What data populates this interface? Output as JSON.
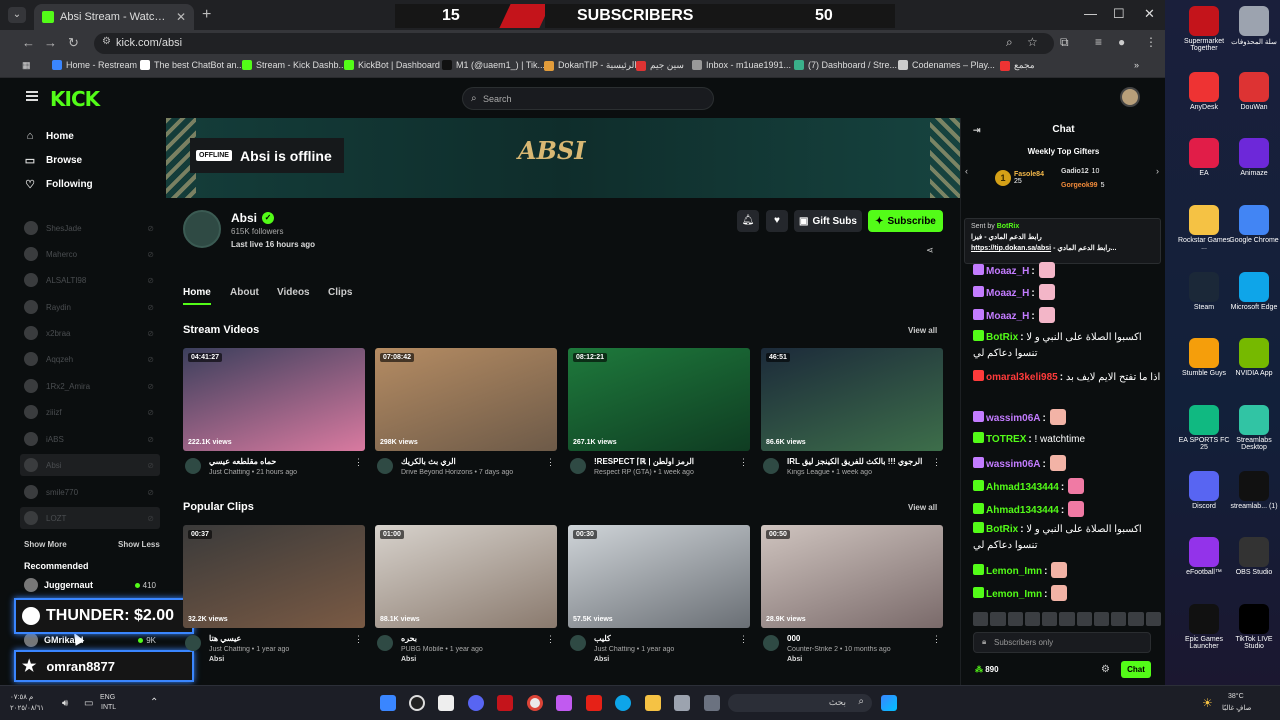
{
  "browser": {
    "tab_title": "Absi Stream - Watch Live on Kick",
    "url": "kick.com/absi",
    "bookmarks": [
      "Home - Restream",
      "The best ChatBot an...",
      "Stream - Kick Dashb...",
      "KickBot | Dashboard",
      "M1 (@uaem1_) | Tik...",
      "DokanTIP - الرئيسية",
      "سين جيم",
      "Inbox - m1uae1991...",
      "(7) Dashboard / Stre...",
      "Codenames – Play...",
      "مجمع"
    ]
  },
  "overlay": {
    "count_left": "15",
    "label": "SUBSCRIBERS",
    "count_right": "50",
    "donation": "THUNDER: $2.00",
    "follower": "omran8877"
  },
  "kick": {
    "search_placeholder": "Search",
    "nav": {
      "home": "Home",
      "browse": "Browse",
      "following": "Following"
    },
    "following_list": [
      "ShesJade",
      "Maherco",
      "ALSALTI98",
      "Raydin",
      "x2braa",
      "Aqqzeh",
      "1Rx2_Amira",
      "ziiizf",
      "iABS",
      "Absi",
      "smile770",
      "LOZT"
    ],
    "show_more": "Show More",
    "show_less": "Show Less",
    "recommended_title": "Recommended",
    "recommended": [
      {
        "name": "Juggernaut",
        "count": "410"
      },
      {
        "name": "GMrikard",
        "count": "9K"
      }
    ]
  },
  "channel": {
    "offline_badge": "OFFLINE",
    "offline_text": "Absi is offline",
    "banner_brand": "ABSI",
    "name": "Absi",
    "followers": "615K followers",
    "last_live": "Last live 16 hours ago",
    "gift_subs": "Gift Subs",
    "subscribe": "Subscribe",
    "tabs": [
      "Home",
      "About",
      "Videos",
      "Clips"
    ],
    "stream_videos_title": "Stream Videos",
    "popular_clips_title": "Popular Clips",
    "view_all": "View all",
    "videos": [
      {
        "duration": "04:41:27",
        "views": "222.1K views",
        "title": "حماه مقلطعه عيسي",
        "meta": "Just Chatting • 21 hours ago",
        "colors": [
          "#3b3f5c",
          "#d97aa0"
        ]
      },
      {
        "duration": "07:08:42",
        "views": "298K views",
        "title": "الري بث بالكريك",
        "meta": "Drive Beyond Horizons • 7 days ago",
        "colors": [
          "#b58c63",
          "#6d5a48"
        ]
      },
      {
        "duration": "08:12:21",
        "views": "267.1K views",
        "title": "!RESPECT ⌈ℝ | الرمز اولطن",
        "meta": "Respect RP (GTA) • 1 week ago",
        "colors": [
          "#1e7a3c",
          "#0f3c22"
        ]
      },
      {
        "duration": "46:51",
        "views": "86.6K views",
        "title": "IRL الرجوي !!! بالكث للفريق الكينجز ليق",
        "meta": "Kings League • 1 week ago",
        "colors": [
          "#1c2a3a",
          "#3d6e4a"
        ]
      }
    ],
    "clips": [
      {
        "duration": "00:37",
        "views": "32.2K views",
        "title": "عيسي هتا",
        "meta": "Just Chatting • 1 year ago",
        "author": "Absi",
        "colors": [
          "#3a3a3a",
          "#7a5a44"
        ]
      },
      {
        "duration": "01:00",
        "views": "88.1K views",
        "title": "بحره",
        "meta": "PUBG Mobile • 1 year ago",
        "author": "Absi",
        "colors": [
          "#d7d2cc",
          "#8a7a6e"
        ]
      },
      {
        "duration": "00:30",
        "views": "57.5K views",
        "title": "كليب",
        "meta": "Just Chatting • 1 year ago",
        "author": "Absi",
        "colors": [
          "#cfd4d8",
          "#6a6f75"
        ]
      },
      {
        "duration": "00:50",
        "views": "28.9K views",
        "title": "000",
        "meta": "Counter-Strike 2 • 10 months ago",
        "author": "Absi",
        "colors": [
          "#cfc4bf",
          "#7a6a6a"
        ]
      }
    ]
  },
  "chat": {
    "title": "Chat",
    "gifters_title": "Weekly Top Gifters",
    "gifters": [
      {
        "name": "Fasole84",
        "count": "25"
      },
      {
        "name": "Gadio12",
        "count": "10"
      },
      {
        "name": "Gorgeok99",
        "count": "5"
      }
    ],
    "medal": "1",
    "pinned": {
      "sent_by": "Sent by",
      "bot": "BotRix",
      "line1": "رابط الدعم المادي - فيزا",
      "line2_link": "https://tip.dokan.sa/absi",
      "line2_rest": " - رابط الدعم المادي..."
    },
    "messages": [
      {
        "user": "Moaaz_H",
        "color": "#c37cff",
        "text": ""
      },
      {
        "user": "Moaaz_H",
        "color": "#c37cff",
        "text": ""
      },
      {
        "user": "Moaaz_H",
        "color": "#c37cff",
        "text": ""
      },
      {
        "user": "BotRix",
        "color": "#53fc18",
        "text": "اكسبوا الصلاة على النبي و لا تنسوا دعاكم لي"
      },
      {
        "user": "omaral3keli985",
        "color": "#ff3b3b",
        "text": "اذا ما تفتح الايم لايف بد"
      },
      {
        "user": "wassim06A",
        "color": "#c37cff",
        "text": ""
      },
      {
        "user": "TOTREX",
        "color": "#53fc18",
        "text": "! watchtime"
      },
      {
        "user": "wassim06A",
        "color": "#c37cff",
        "text": ""
      },
      {
        "user": "Ahmad1343444",
        "color": "#53fc18",
        "text": ""
      },
      {
        "user": "Ahmad1343444",
        "color": "#53fc18",
        "text": ""
      },
      {
        "user": "BotRix",
        "color": "#53fc18",
        "text": "اكسبوا الصلاة على النبي و لا تنسوا دعاكم لي"
      },
      {
        "user": "Lemon_Imn",
        "color": "#53fc18",
        "text": ""
      },
      {
        "user": "Lemon_Imn",
        "color": "#53fc18",
        "text": ""
      }
    ],
    "input_placeholder": "Subscribers only",
    "points": "890",
    "send": "Chat"
  },
  "desktop_icons": [
    "Supermarket Together",
    "سلة المحذوفات",
    "AnyDesk",
    "DouWan",
    "EA",
    "Animaze",
    "Rockstar Games ...",
    "Google Chrome",
    "Steam",
    "Microsoft Edge",
    "Stumble Guys",
    "NVIDIA App",
    "EA SPORTS FC 25",
    "Streamlabs Desktop",
    "Discord",
    "streamlab... (1)",
    "eFootball™",
    "OBS Studio",
    "Epic Games Launcher",
    "TikTok LIVE Studio"
  ],
  "taskbar": {
    "search": "بحث",
    "lang": "ENG",
    "lang2": "INTL",
    "time": "م ٠٧:٥٨",
    "date": "٢٠٢٥/٠٨/٦١",
    "weather_temp": "38°C",
    "weather_text": "صافٍ غالبًا"
  }
}
